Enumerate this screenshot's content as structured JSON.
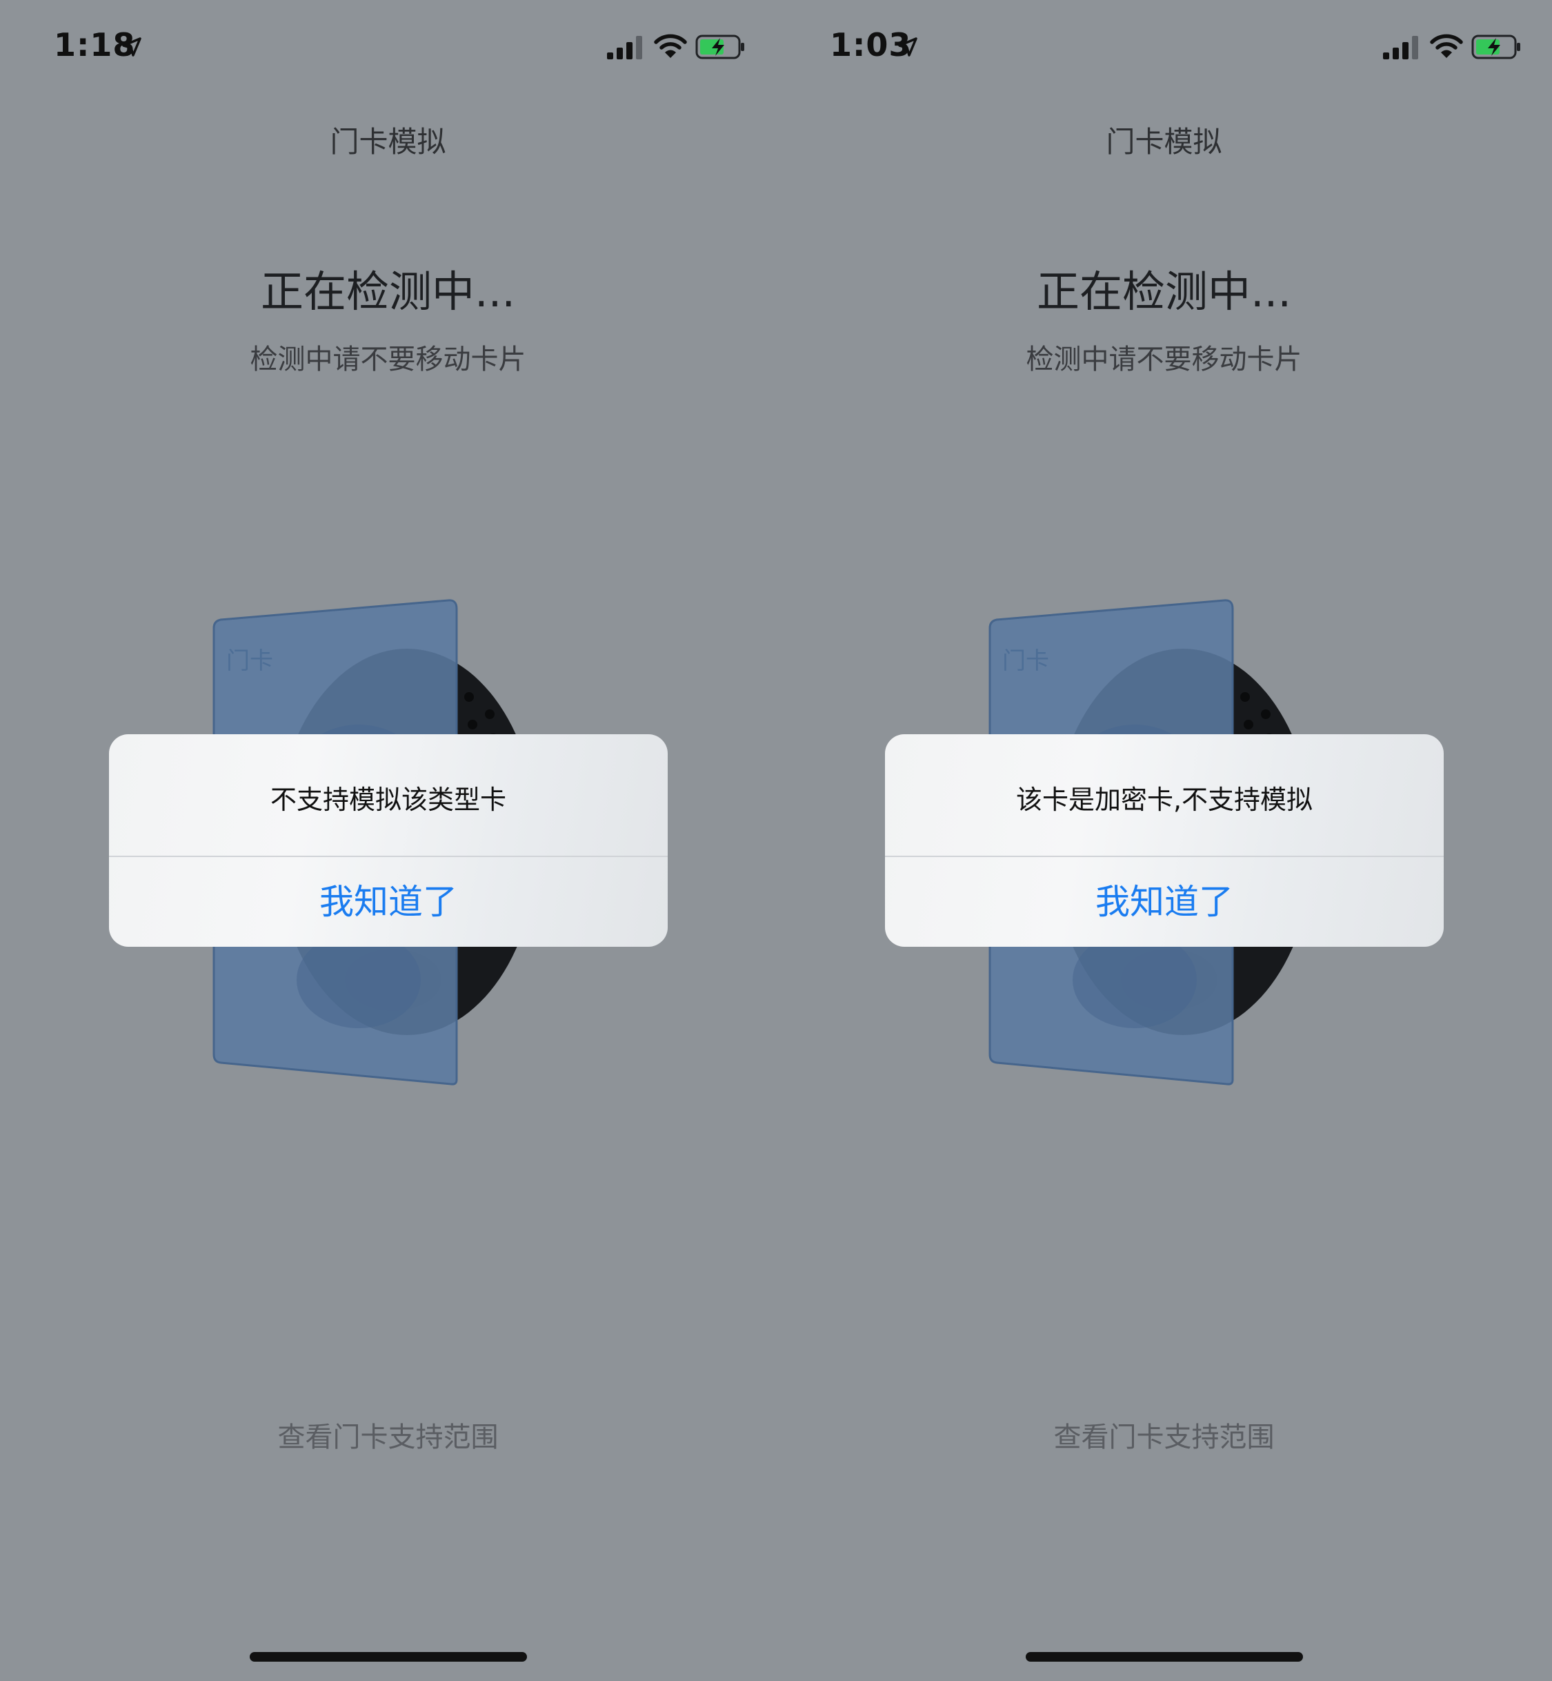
{
  "screens": [
    {
      "status_bar": {
        "time": "1:18"
      },
      "nav_title": "门卡模拟",
      "status_title": "正在检测中...",
      "status_subtitle": "检测中请不要移动卡片",
      "card_label": "门卡",
      "alert": {
        "message": "不支持模拟该类型卡",
        "button": "我知道了"
      },
      "support_link": "查看门卡支持范围"
    },
    {
      "status_bar": {
        "time": "1:03"
      },
      "nav_title": "门卡模拟",
      "status_title": "正在检测中...",
      "status_subtitle": "检测中请不要移动卡片",
      "card_label": "门卡",
      "alert": {
        "message": "该卡是加密卡,不支持模拟",
        "button": "我知道了"
      },
      "support_link": "查看门卡支持范围"
    }
  ],
  "colors": {
    "background": "#8e9398",
    "alert_button": "#1a7cf0",
    "card": "#5b7aa0",
    "battery_charge": "#34c759"
  }
}
